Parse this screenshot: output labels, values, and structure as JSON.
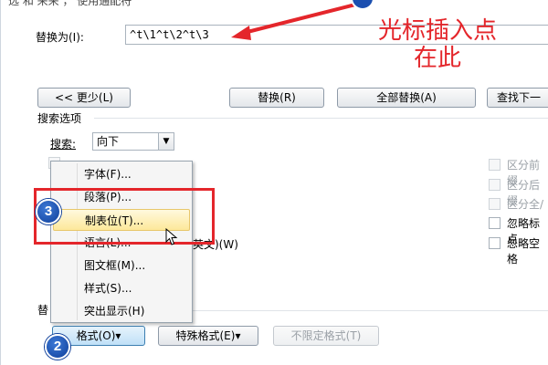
{
  "top_partial_text": "选       和 来来 ，   使用通配符",
  "replace_with": {
    "label": "替换为(I):",
    "value": "^t\\1^t\\2^t\\3"
  },
  "callout": {
    "line1": "光标插入点",
    "line2": "在此"
  },
  "buttons": {
    "less": "<< 更少(L)",
    "replace": "替换(R)",
    "replace_all": "全部替换(A)",
    "find_next": "查找下一"
  },
  "search_options": {
    "title": "搜索选项",
    "search_label": "搜索:",
    "search_value": "向下"
  },
  "right_options": [
    "区分前缀",
    "区分后缀",
    "区分全/",
    "忽略标点",
    "忽略空格"
  ],
  "hidden_option_suffix": "英文)(W)",
  "bottom": {
    "replace_section_label": "替",
    "format_button": "格式(O)▾",
    "special_button": "特殊格式(E)▾",
    "no_format_button": "不限定格式(T)"
  },
  "menu": {
    "items": [
      "字体(F)...",
      "段落(P)...",
      "制表位(T)...",
      "语言(L)...",
      "图文框(M)...",
      "样式(S)...",
      "突出显示(H)"
    ],
    "highlighted_index": 2
  },
  "badges": {
    "b2": "2",
    "b3": "3"
  },
  "colors": {
    "annotation_red": "#e4262b",
    "badge_blue": "#1b4fb0"
  }
}
